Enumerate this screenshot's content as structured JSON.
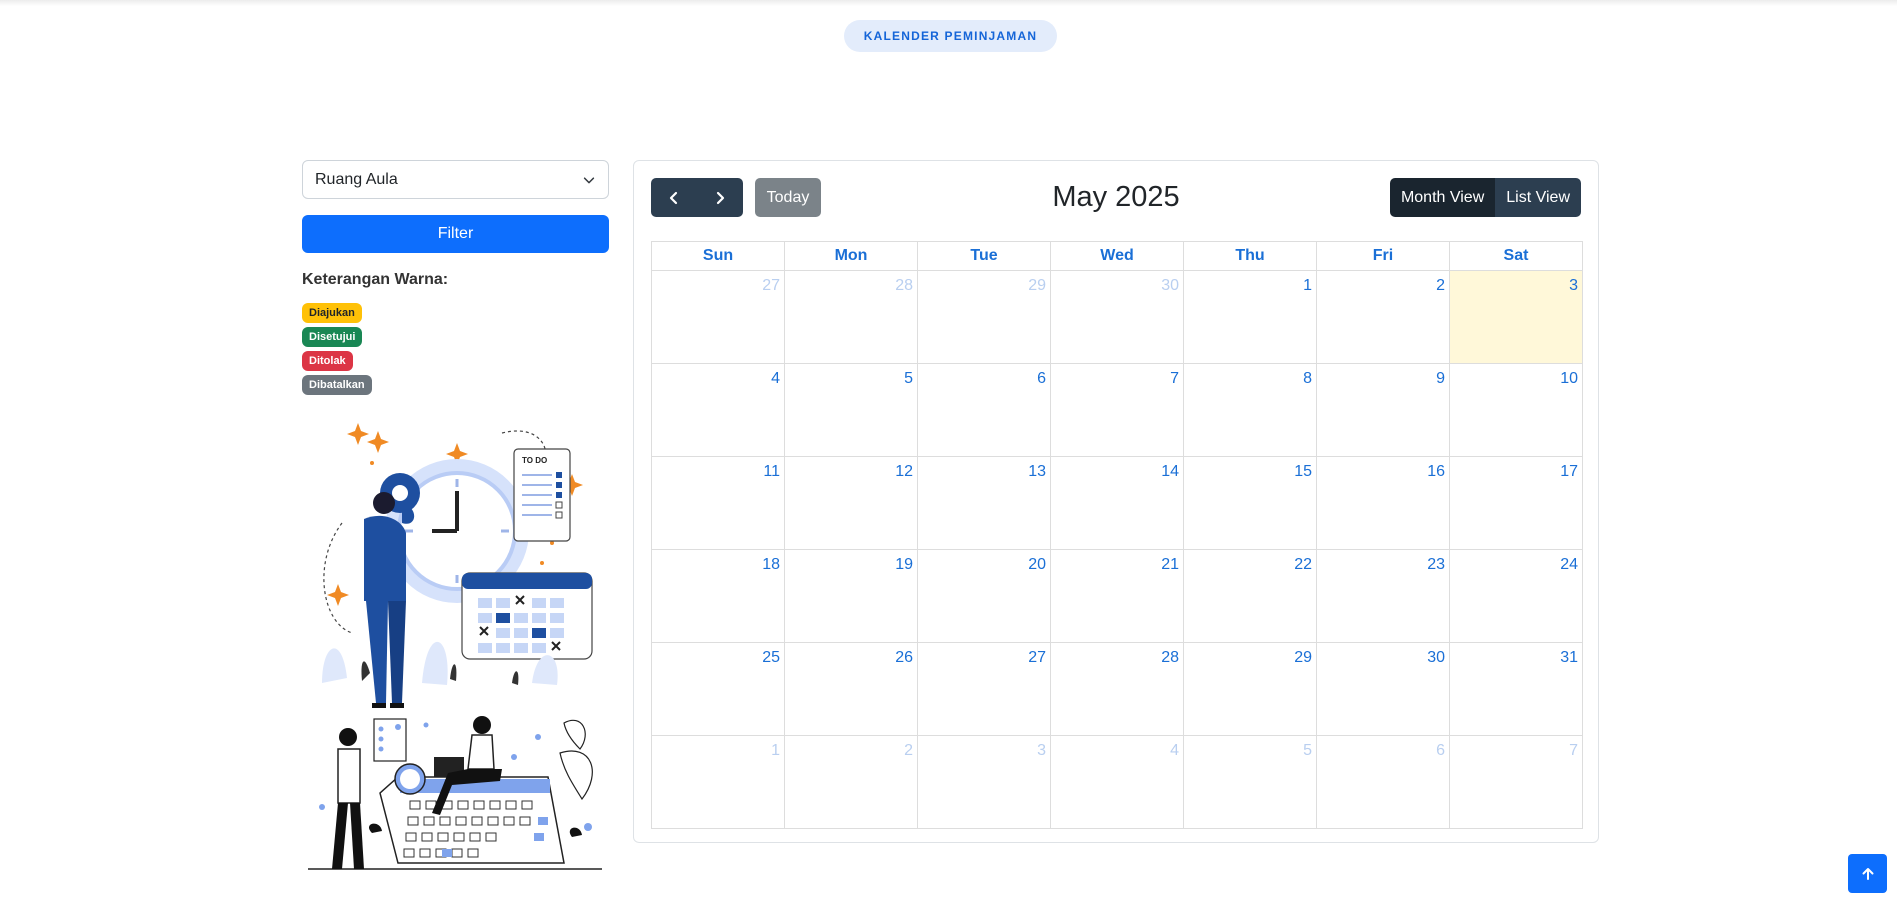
{
  "header": {
    "pill_label": "KALENDER PEMINJAMAN"
  },
  "sidebar": {
    "room_select": {
      "value": "Ruang Aula"
    },
    "filter_label": "Filter",
    "legend_title": "Keterangan Warna:",
    "legend": [
      {
        "label": "Diajukan",
        "color": "#ffc107"
      },
      {
        "label": "Disetujui",
        "color": "#198754"
      },
      {
        "label": "Ditolak",
        "color": "#dc3545"
      },
      {
        "label": "Dibatalkan",
        "color": "#6c757d"
      }
    ],
    "illustration_text": "TO DO"
  },
  "calendar": {
    "title": "May 2025",
    "today_label": "Today",
    "views": [
      "Month View",
      "List View"
    ],
    "active_view": "Month View",
    "weekdays": [
      "Sun",
      "Mon",
      "Tue",
      "Wed",
      "Thu",
      "Fri",
      "Sat"
    ],
    "weeks": [
      [
        {
          "d": "27",
          "other": true
        },
        {
          "d": "28",
          "other": true
        },
        {
          "d": "29",
          "other": true
        },
        {
          "d": "30",
          "other": true
        },
        {
          "d": "1"
        },
        {
          "d": "2"
        },
        {
          "d": "3",
          "today": true
        }
      ],
      [
        {
          "d": "4"
        },
        {
          "d": "5"
        },
        {
          "d": "6"
        },
        {
          "d": "7"
        },
        {
          "d": "8"
        },
        {
          "d": "9"
        },
        {
          "d": "10"
        }
      ],
      [
        {
          "d": "11"
        },
        {
          "d": "12"
        },
        {
          "d": "13"
        },
        {
          "d": "14"
        },
        {
          "d": "15"
        },
        {
          "d": "16"
        },
        {
          "d": "17"
        }
      ],
      [
        {
          "d": "18"
        },
        {
          "d": "19"
        },
        {
          "d": "20"
        },
        {
          "d": "21"
        },
        {
          "d": "22"
        },
        {
          "d": "23"
        },
        {
          "d": "24"
        }
      ],
      [
        {
          "d": "25"
        },
        {
          "d": "26"
        },
        {
          "d": "27"
        },
        {
          "d": "28"
        },
        {
          "d": "29"
        },
        {
          "d": "30"
        },
        {
          "d": "31"
        }
      ],
      [
        {
          "d": "1",
          "other": true
        },
        {
          "d": "2",
          "other": true
        },
        {
          "d": "3",
          "other": true
        },
        {
          "d": "4",
          "other": true
        },
        {
          "d": "5",
          "other": true
        },
        {
          "d": "6",
          "other": true
        },
        {
          "d": "7",
          "other": true
        }
      ]
    ]
  },
  "colors": {
    "primary": "#0d6efd",
    "toolbar": "#2c3e50",
    "day_number": "#1a6fd6",
    "today_bg": "#fff8d9"
  }
}
